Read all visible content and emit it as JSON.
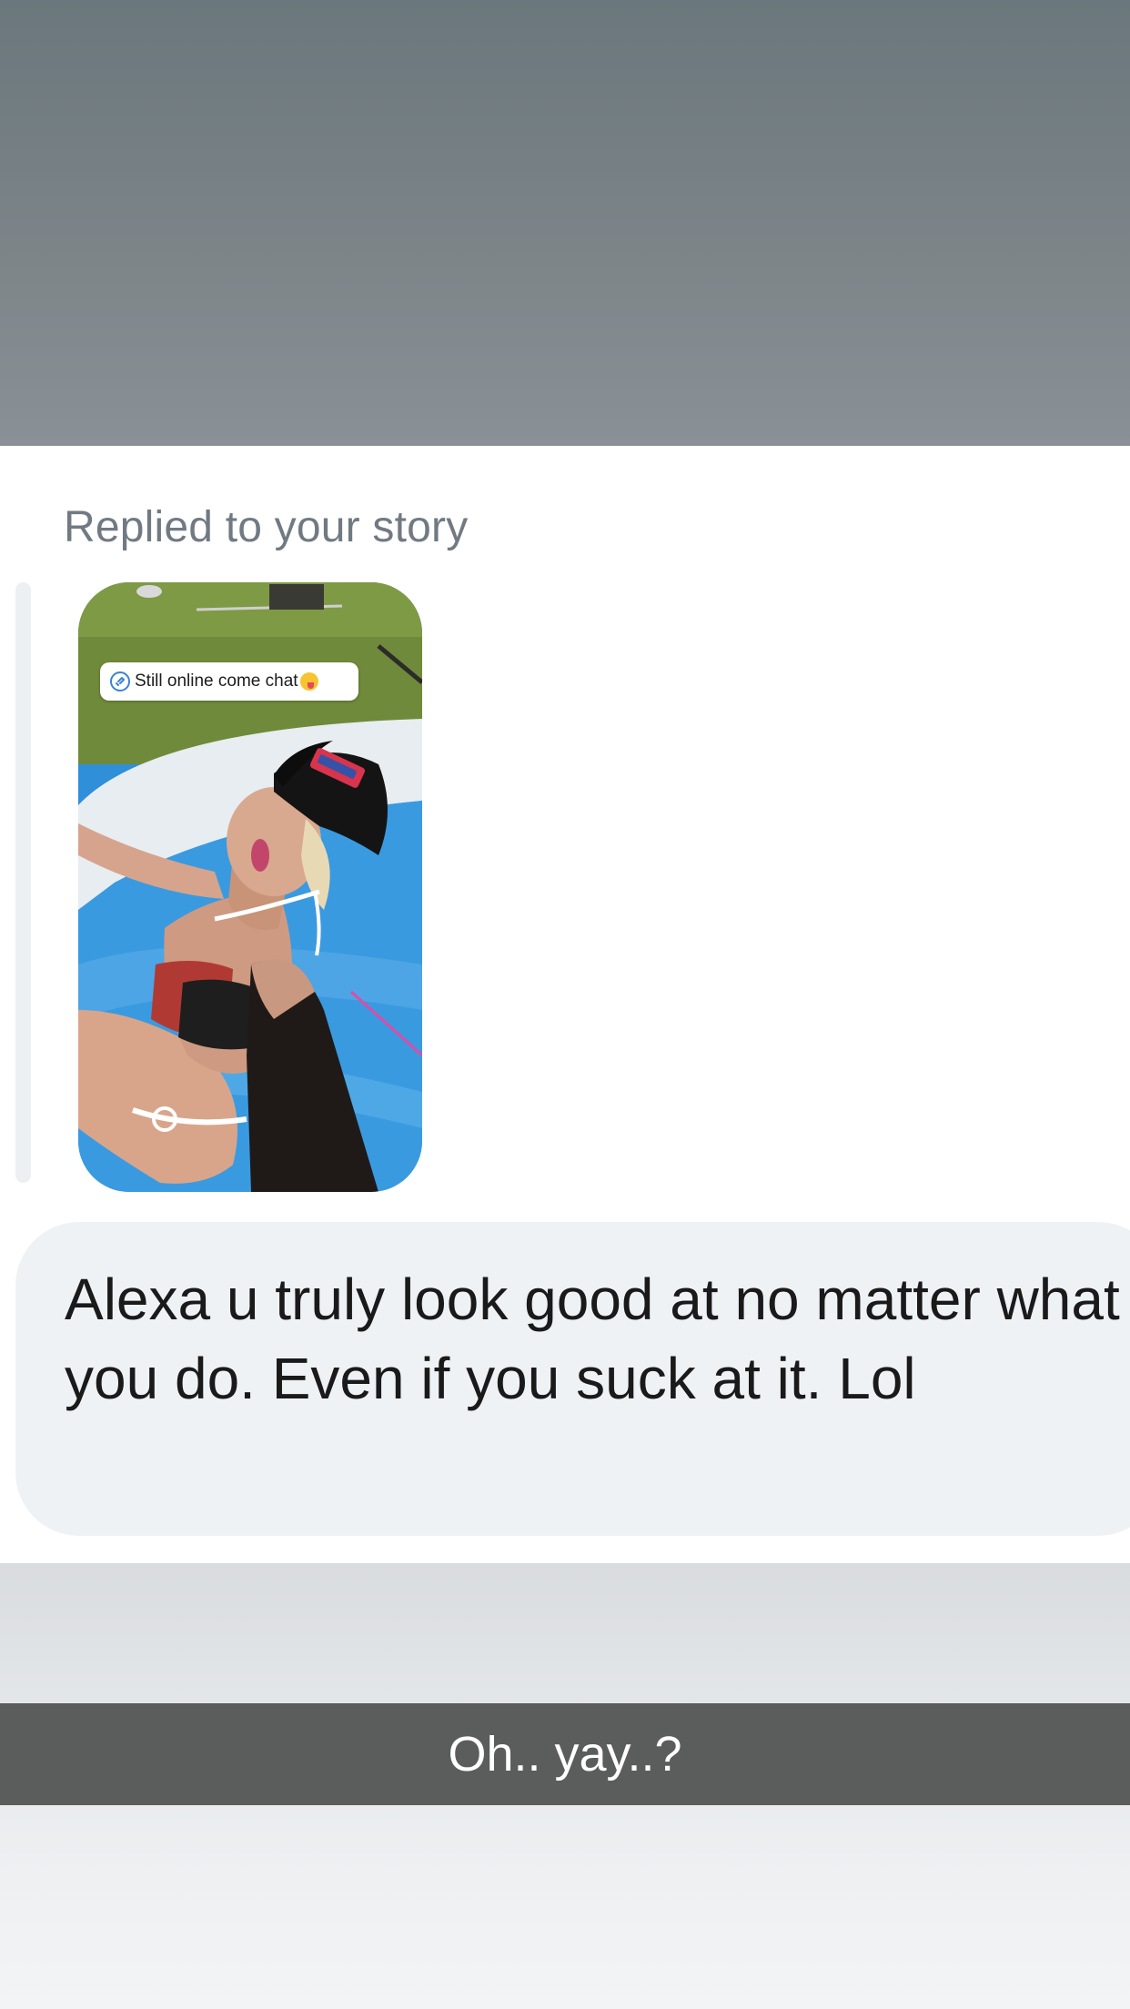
{
  "header": {
    "reply_label": "Replied to your story"
  },
  "story": {
    "sticker_text": "Still online come chat",
    "sticker_icon": "link-icon",
    "sticker_emoji": "winking-tongue-emoji"
  },
  "message": {
    "text": "Alexa u truly look good at no matter what you do. Even if you suck at it. Lol"
  },
  "caption": {
    "text": "Oh.. yay..?"
  },
  "colors": {
    "bubble": "#eff2f5",
    "reply_label": "#717a83",
    "caption_bar": "#5b5c5c"
  }
}
